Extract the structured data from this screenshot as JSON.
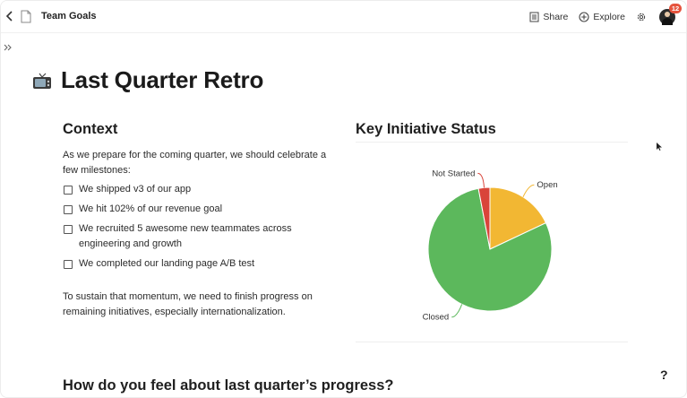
{
  "topbar": {
    "back_icon": "chevron-left-icon",
    "doc_icon": "document-icon",
    "title": "Team Goals",
    "actions": [
      {
        "label": "Share",
        "icon": "document-share-icon"
      },
      {
        "label": "Explore",
        "icon": "plus-circle-icon"
      }
    ],
    "settings_icon": "gear-icon",
    "notification_count": "12"
  },
  "page": {
    "emoji_icon": "television-icon",
    "title": "Last Quarter Retro"
  },
  "context": {
    "heading": "Context",
    "intro": "As we prepare for the coming quarter, we should celebrate a few milestones:",
    "checklist": [
      {
        "text": "We shipped v3 of our app",
        "checked": false
      },
      {
        "text": "We hit 102% of our revenue goal",
        "checked": false
      },
      {
        "text": "We recruited 5 awesome new teammates across engineering and growth",
        "checked": false
      },
      {
        "text": "We completed our landing page A/B test",
        "checked": false
      }
    ],
    "closing": "To sustain that momentum, we need to finish progress on remaining initiatives, especially internationalization."
  },
  "chart_data": {
    "type": "pie",
    "title": "Key Initiative Status",
    "labels": [
      "Open",
      "Closed",
      "Not Started"
    ],
    "values": [
      18,
      79,
      3
    ],
    "colors": [
      "#f2b733",
      "#5cb85c",
      "#d9443a"
    ],
    "legend": "none"
  },
  "bottom": {
    "question": "How do you feel about last quarter’s progress?",
    "help_label": "?"
  }
}
